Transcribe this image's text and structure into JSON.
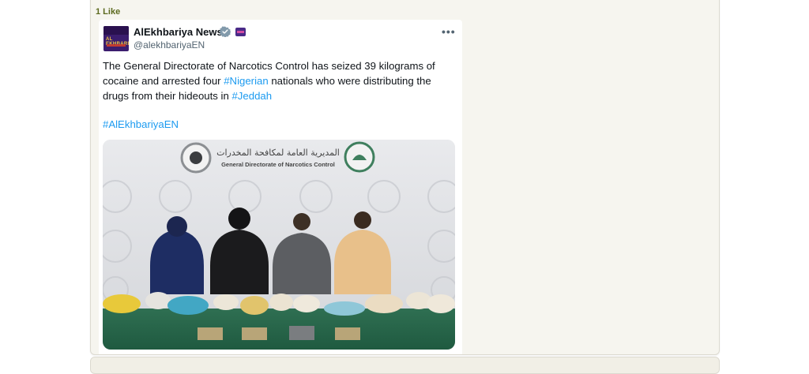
{
  "post": {
    "like_count_label": "1 Like"
  },
  "embed": {
    "account_name": "AlEkhbariya News",
    "handle": "@alekhbariyaEN",
    "more_icon": "more-horizontal-icon",
    "avatar_text": "AL EKHBARIYA",
    "text_part1": "The General Directorate of Narcotics Control has seized 39 kilograms of cocaine and arrested four ",
    "hashtag_nigerian": "#Nigerian",
    "text_part2": " nationals who were distributing the drugs from their hideouts in ",
    "hashtag_jeddah": "#Jeddah",
    "hashtag_channel": "#AlEkhbariyaEN",
    "media": {
      "banner_arabic": "المديرية العامة لمكافحة المخدرات",
      "banner_english": "General Directorate of Narcotics Control"
    }
  },
  "colors": {
    "link": "#1d9bf0",
    "forum_bg": "#f6f5ef",
    "verified": "#829aab"
  }
}
